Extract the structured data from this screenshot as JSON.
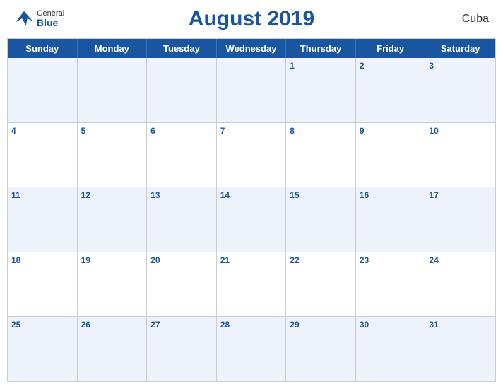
{
  "header": {
    "title": "August 2019",
    "country": "Cuba",
    "logo": {
      "general": "General",
      "blue": "Blue"
    }
  },
  "calendar": {
    "day_headers": [
      "Sunday",
      "Monday",
      "Tuesday",
      "Wednesday",
      "Thursday",
      "Friday",
      "Saturday"
    ],
    "weeks": [
      [
        {
          "date": null
        },
        {
          "date": null
        },
        {
          "date": null
        },
        {
          "date": null
        },
        {
          "date": 1
        },
        {
          "date": 2
        },
        {
          "date": 3
        }
      ],
      [
        {
          "date": 4
        },
        {
          "date": 5
        },
        {
          "date": 6
        },
        {
          "date": 7
        },
        {
          "date": 8
        },
        {
          "date": 9
        },
        {
          "date": 10
        }
      ],
      [
        {
          "date": 11
        },
        {
          "date": 12
        },
        {
          "date": 13
        },
        {
          "date": 14
        },
        {
          "date": 15
        },
        {
          "date": 16
        },
        {
          "date": 17
        }
      ],
      [
        {
          "date": 18
        },
        {
          "date": 19
        },
        {
          "date": 20
        },
        {
          "date": 21
        },
        {
          "date": 22
        },
        {
          "date": 23
        },
        {
          "date": 24
        }
      ],
      [
        {
          "date": 25
        },
        {
          "date": 26
        },
        {
          "date": 27
        },
        {
          "date": 28
        },
        {
          "date": 29
        },
        {
          "date": 30
        },
        {
          "date": 31
        }
      ]
    ]
  }
}
